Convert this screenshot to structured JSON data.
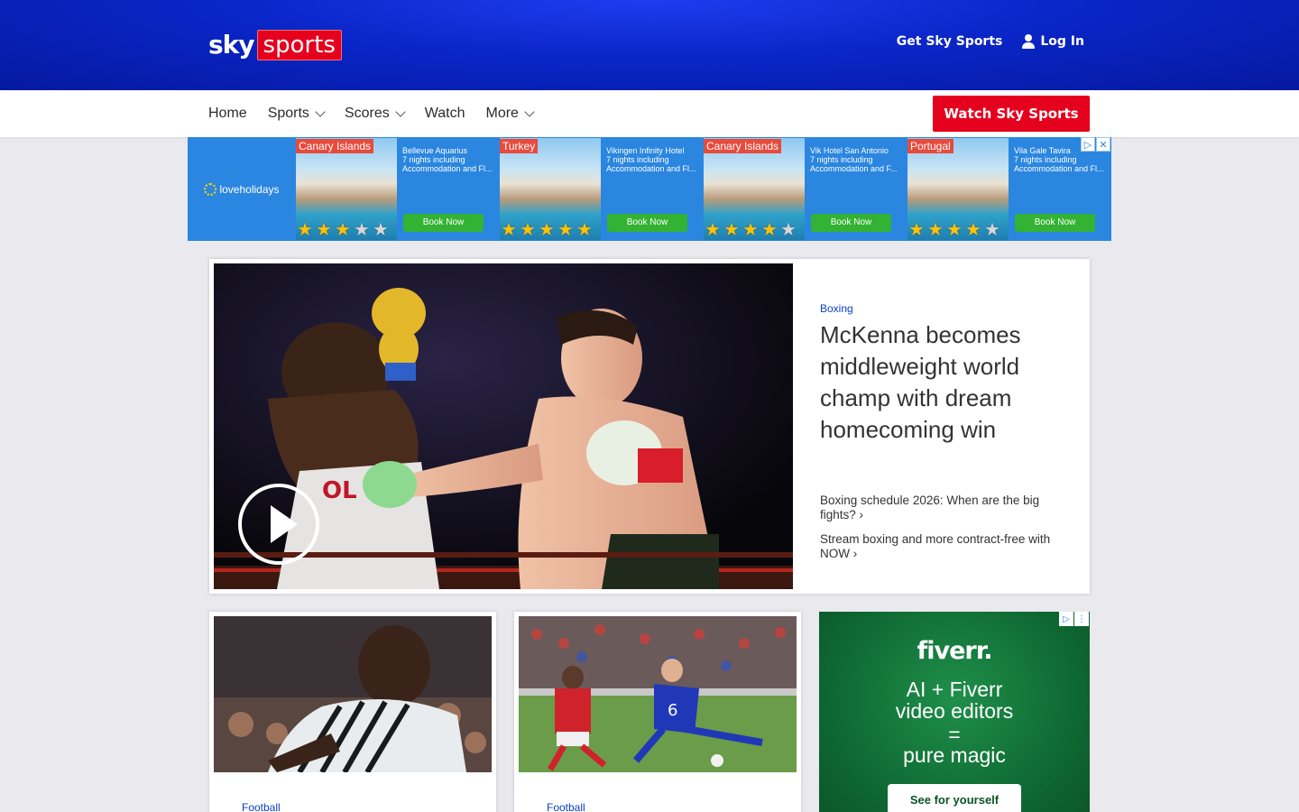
{
  "header": {
    "logo_sky": "sky",
    "logo_sports": "sports",
    "get_sky_sports": "Get Sky Sports",
    "log_in": "Log In"
  },
  "nav": {
    "items": [
      {
        "label": "Home",
        "dropdown": false
      },
      {
        "label": "Sports",
        "dropdown": true
      },
      {
        "label": "Scores",
        "dropdown": true
      },
      {
        "label": "Watch",
        "dropdown": false
      },
      {
        "label": "More",
        "dropdown": true
      }
    ],
    "cta": "Watch Sky Sports"
  },
  "ad_banner": {
    "brand": "loveholidays",
    "deals": [
      {
        "tag": "Canary Islands",
        "name": "Bellevue Aquarius",
        "nights": "7 nights including",
        "desc": "Accommodation and Fl...",
        "stars": 3,
        "cta": "Book Now"
      },
      {
        "tag": "Turkey",
        "name": "Vikingen Infinity Hotel",
        "nights": "7 nights including",
        "desc": "Accommodation and Fl...",
        "stars": 5,
        "cta": "Book Now"
      },
      {
        "tag": "Canary Islands",
        "name": "Vik Hotel San Antonio",
        "nights": "7 nights including",
        "desc": "Accommodation and F...",
        "stars": 4,
        "cta": "Book Now"
      },
      {
        "tag": "Portugal",
        "name": "Vila Gale Tavira",
        "nights": "7 nights including",
        "desc": "Accommodation and Fl...",
        "stars": 4,
        "cta": "Book Now"
      }
    ]
  },
  "hero": {
    "category": "Boxing",
    "title": "McKenna becomes middleweight world champ with dream homecoming win",
    "links": [
      "Boxing schedule 2026: When are the big fights?",
      "Stream boxing and more contract-free with NOW"
    ]
  },
  "cards": [
    {
      "category": "Football"
    },
    {
      "category": "Football"
    }
  ],
  "fiverr_ad": {
    "logo": "fiverr.",
    "lines": [
      "AI + Fiverr",
      "video editors",
      "=",
      "pure magic"
    ],
    "cta": "See for yourself"
  },
  "colors": {
    "brand_blue": "#0a26c8",
    "brand_red": "#e5001e",
    "link_blue": "#0a3fcb",
    "fiverr_green": "#0f6a33"
  }
}
